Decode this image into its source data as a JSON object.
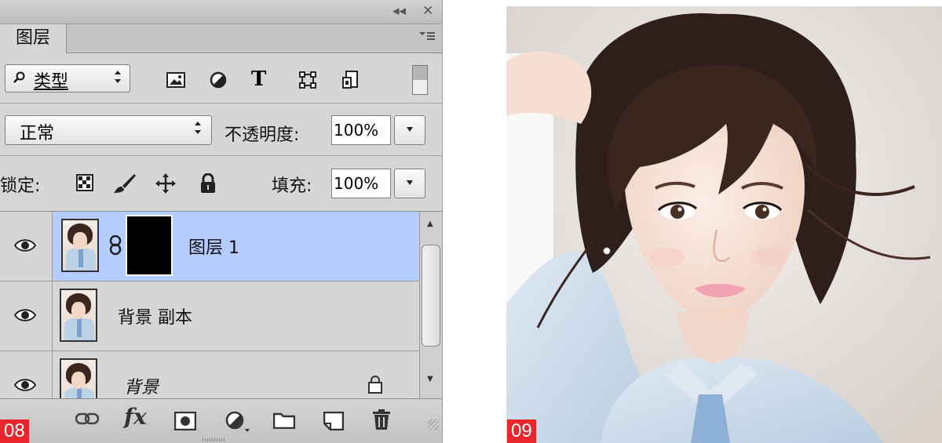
{
  "panel": {
    "window_controls": {
      "collapse": "◂◂",
      "close": "✕"
    },
    "tab": {
      "label": "图层",
      "menu_icon": "panel-menu-icon"
    },
    "filter": {
      "kind_label": "类型",
      "icons": [
        "image-filter-icon",
        "adjustment-filter-icon",
        "type-filter-icon",
        "shape-filter-icon",
        "smart-object-filter-icon"
      ],
      "type_icon_glyph": "T"
    },
    "blend": {
      "mode": "正常",
      "opacity_label": "不透明度:",
      "opacity_value": "100%"
    },
    "lock": {
      "label": "锁定:",
      "fill_label": "填充:",
      "fill_value": "100%"
    },
    "layers": [
      {
        "name": "图层 1",
        "selected": true,
        "has_mask": true,
        "locked": false
      },
      {
        "name": "背景 副本",
        "selected": false,
        "has_mask": false,
        "locked": false
      },
      {
        "name": "背景",
        "selected": false,
        "has_mask": false,
        "locked": true
      }
    ],
    "bottom_icons": [
      "link-layers-icon",
      "fx-icon",
      "add-mask-icon",
      "adjustment-layer-icon",
      "new-group-icon",
      "new-layer-icon",
      "delete-layer-icon"
    ],
    "fx_label": "fx"
  },
  "badges": {
    "left": "08",
    "right": "09"
  },
  "colors": {
    "selected_row": "#b4ccff",
    "badge": "#e8262b",
    "panel_bg": "#d6d6d6"
  }
}
